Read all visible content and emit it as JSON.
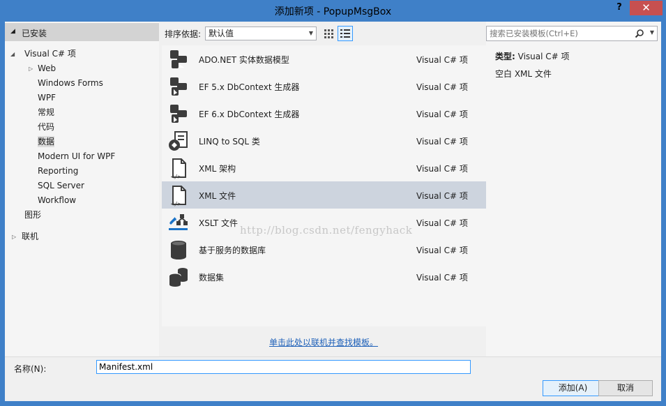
{
  "window": {
    "title": "添加新项 - PopupMsgBox",
    "help_label": "?",
    "close_label": "✕"
  },
  "sidebar": {
    "header": "已安装",
    "items": [
      {
        "label": "Visual C# 项"
      },
      {
        "label": "Web"
      },
      {
        "label": "Windows Forms"
      },
      {
        "label": "WPF"
      },
      {
        "label": "常规"
      },
      {
        "label": "代码"
      },
      {
        "label": "数据"
      },
      {
        "label": "Modern UI for WPF"
      },
      {
        "label": "Reporting"
      },
      {
        "label": "SQL Server"
      },
      {
        "label": "Workflow"
      },
      {
        "label": "图形"
      },
      {
        "label": "联机"
      }
    ]
  },
  "toolbar": {
    "sort_label": "排序依据:",
    "sort_value": "默认值"
  },
  "search": {
    "placeholder": "搜索已安装模板(Ctrl+E)"
  },
  "templates": [
    {
      "name": "ADO.NET 实体数据模型",
      "lang": "Visual C# 项",
      "icon": "entity-model-icon"
    },
    {
      "name": "EF 5.x DbContext 生成器",
      "lang": "Visual C# 项",
      "icon": "dbcontext-generator-icon"
    },
    {
      "name": "EF 6.x DbContext 生成器",
      "lang": "Visual C# 项",
      "icon": "dbcontext-generator-icon"
    },
    {
      "name": "LINQ to SQL 类",
      "lang": "Visual C# 项",
      "icon": "linq-to-sql-icon"
    },
    {
      "name": "XML 架构",
      "lang": "Visual C# 项",
      "icon": "xml-schema-icon"
    },
    {
      "name": "XML 文件",
      "lang": "Visual C# 项",
      "icon": "xml-file-icon"
    },
    {
      "name": "XSLT 文件",
      "lang": "Visual C# 项",
      "icon": "xslt-file-icon"
    },
    {
      "name": "基于服务的数据库",
      "lang": "Visual C# 项",
      "icon": "database-icon"
    },
    {
      "name": "数据集",
      "lang": "Visual C# 项",
      "icon": "dataset-icon"
    }
  ],
  "details": {
    "type_label": "类型:",
    "type_value": "Visual C# 项",
    "description": "空白 XML 文件"
  },
  "online_link": "单击此处以联机并查找模板。",
  "watermark": "http://blog.csdn.net/fengyhack",
  "bottom": {
    "name_label": "名称(N):",
    "name_value": "Manifest.xml",
    "add_label": "添加(A)",
    "cancel_label": "取消"
  }
}
